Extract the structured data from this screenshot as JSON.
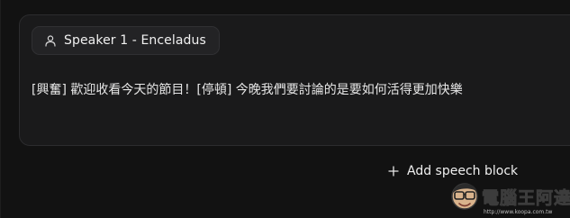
{
  "speech_block": {
    "speaker_label": "Speaker 1 - Enceladus",
    "speaker_icon": "user-icon",
    "text": "[興奮] 歡迎收看今天的節目！[停頓] 今晚我們要討論的是要如何活得更加快樂"
  },
  "actions": {
    "add_block_label": "Add speech block",
    "add_block_icon": "plus-icon"
  },
  "watermark": {
    "title": "電腦王阿達",
    "url": "http://www.koopa.com.tw"
  },
  "colors": {
    "background": "#121212",
    "card": "#1a1a1b",
    "chip": "#232325",
    "text": "#e6e6e6"
  }
}
